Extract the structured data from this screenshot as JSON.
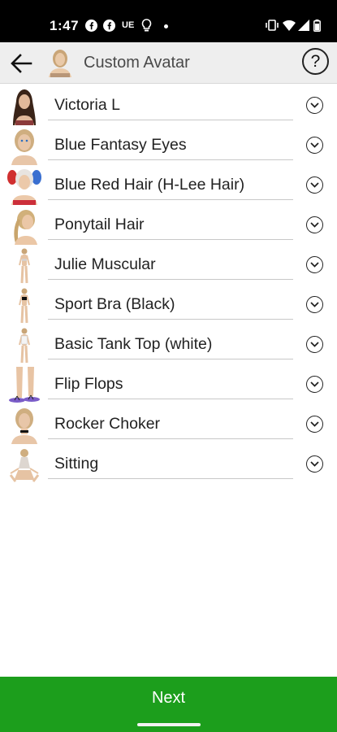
{
  "status_bar": {
    "time": "1:47",
    "icons": [
      "facebook-icon",
      "facebook-icon",
      "ue-badge-icon",
      "lightbulb-icon",
      "dot-icon",
      "vibrate-icon",
      "wifi-icon",
      "signal-icon",
      "battery-icon"
    ],
    "ue_badge": "UE"
  },
  "app_bar": {
    "title": "Custom Avatar",
    "help_label": "?",
    "background": "#eeeeee"
  },
  "items": [
    {
      "label": "Victoria L",
      "thumb": "portrait-dark-hair"
    },
    {
      "label": "Blue Fantasy Eyes",
      "thumb": "portrait-blonde"
    },
    {
      "label": "Blue Red Hair (H-Lee Hair)",
      "thumb": "portrait-blue-red-pigtails"
    },
    {
      "label": "Ponytail Hair",
      "thumb": "portrait-ponytail"
    },
    {
      "label": "Julie Muscular",
      "thumb": "full-body-figure"
    },
    {
      "label": "Sport Bra (Black)",
      "thumb": "full-body-black-bra"
    },
    {
      "label": "Basic Tank Top (white)",
      "thumb": "full-body-tank-top"
    },
    {
      "label": "Flip Flops",
      "thumb": "legs-flip-flops"
    },
    {
      "label": "Rocker Choker",
      "thumb": "portrait-choker"
    },
    {
      "label": "Sitting",
      "thumb": "sitting-pose"
    }
  ],
  "next_button": {
    "label": "Next",
    "color": "#1c9e1c"
  }
}
